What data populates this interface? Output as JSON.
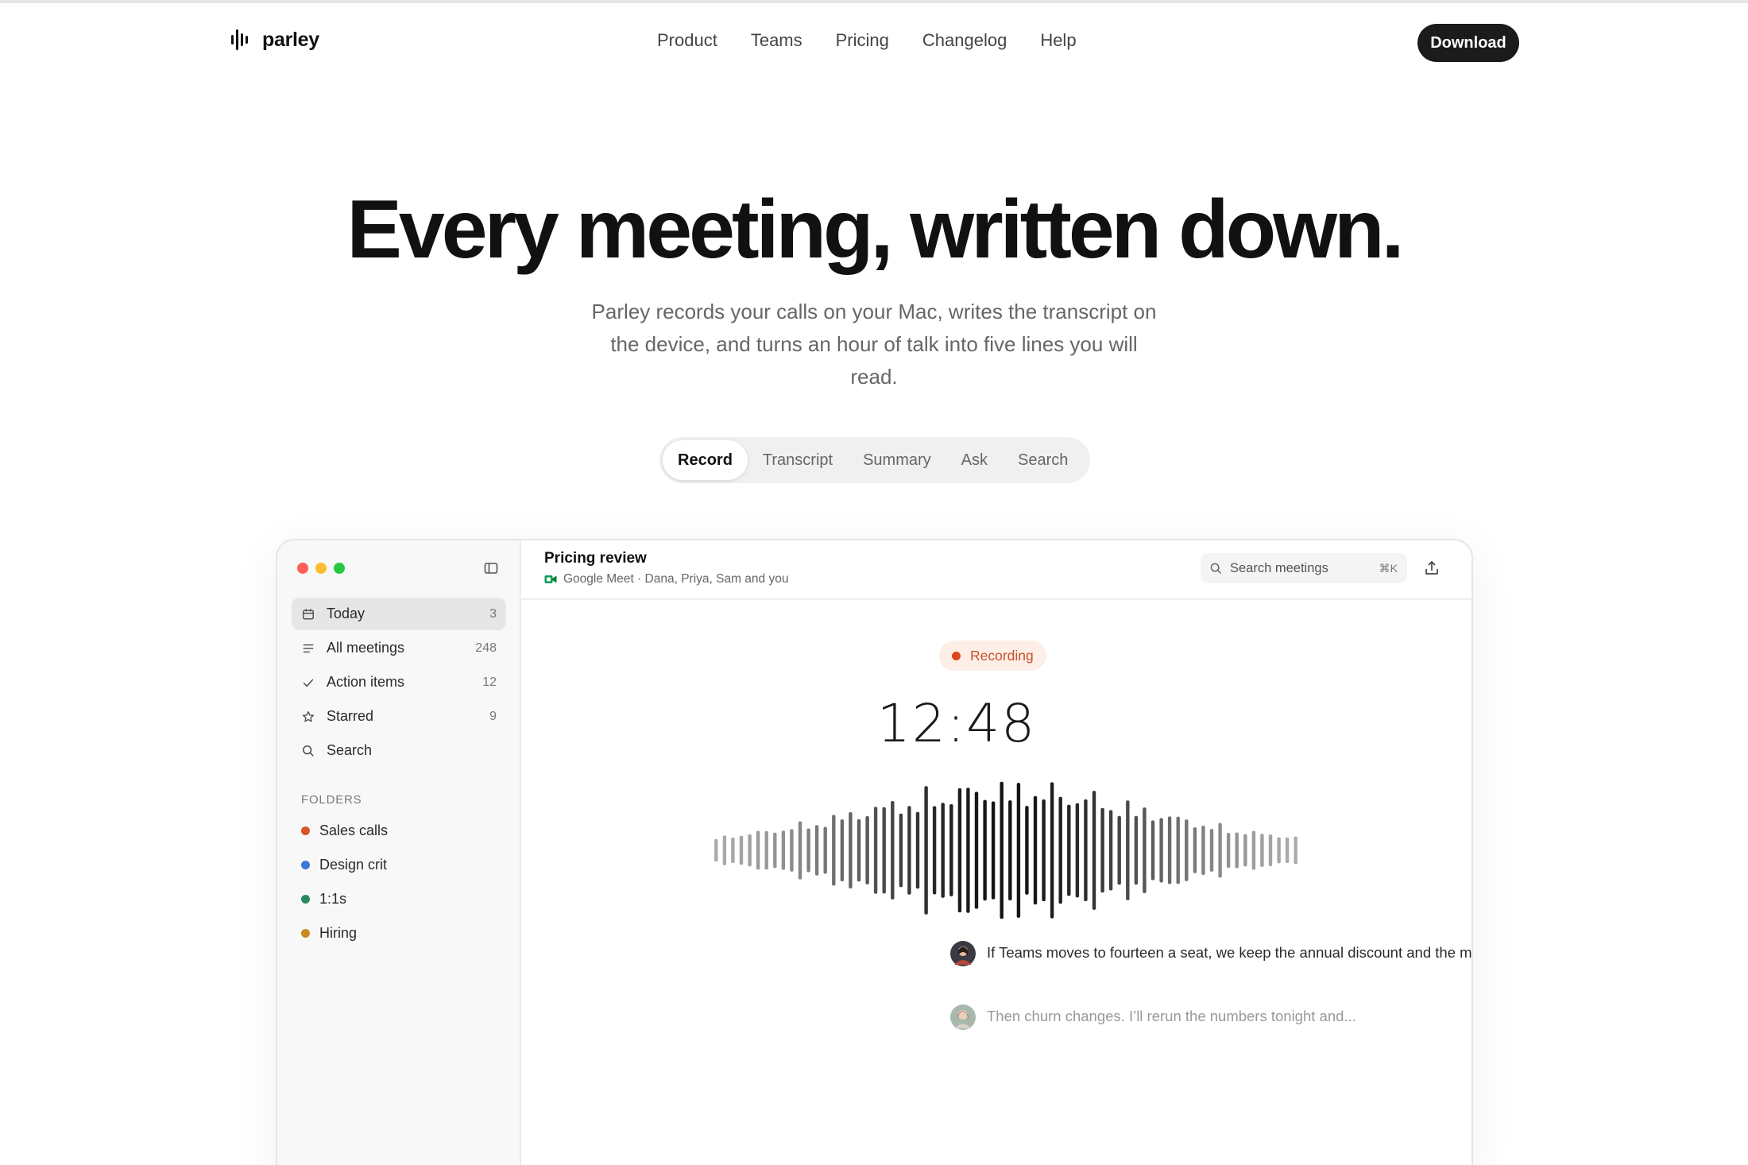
{
  "brand": {
    "name": "parley"
  },
  "nav": {
    "items": [
      "Product",
      "Teams",
      "Pricing",
      "Changelog",
      "Help"
    ],
    "download_label": "Download"
  },
  "hero": {
    "title": "Every meeting, written down.",
    "subtitle": "Parley records your calls on your Mac, writes the transcript on the device, and turns an hour of talk into five lines you will read."
  },
  "tabs": {
    "items": [
      "Record",
      "Transcript",
      "Summary",
      "Ask",
      "Search"
    ],
    "active": "Record"
  },
  "app": {
    "sidebar": {
      "items": [
        {
          "label": "Today",
          "count": "3",
          "icon": "calendar-icon"
        },
        {
          "label": "All meetings",
          "count": "248",
          "icon": "list-icon"
        },
        {
          "label": "Action items",
          "count": "12",
          "icon": "check-icon"
        },
        {
          "label": "Starred",
          "count": "9",
          "icon": "star-icon"
        },
        {
          "label": "Search",
          "count": "",
          "icon": "search-icon"
        }
      ],
      "folders_label": "FOLDERS",
      "folders": [
        {
          "label": "Sales calls",
          "color": "#d9532b"
        },
        {
          "label": "Design crit",
          "color": "#3b78d8"
        },
        {
          "label": "1:1s",
          "color": "#2a8a5e"
        },
        {
          "label": "Hiring",
          "color": "#c98a1e"
        }
      ]
    },
    "header": {
      "title": "Pricing review",
      "subtitle": "Google Meet · Dana, Priya, Sam and you",
      "search_placeholder": "Search meetings",
      "search_shortcut": "⌘K"
    },
    "recording": {
      "badge": "Recording",
      "timer": "12:48"
    },
    "transcript": [
      {
        "text": "If Teams moves to fourteen a seat, we keep the annual discount and the math still works."
      },
      {
        "text": "Then churn changes. I’ll rerun the numbers tonight and..."
      }
    ],
    "colors": {
      "recording": "#d9481b",
      "accent": "#1b1b1b"
    }
  }
}
